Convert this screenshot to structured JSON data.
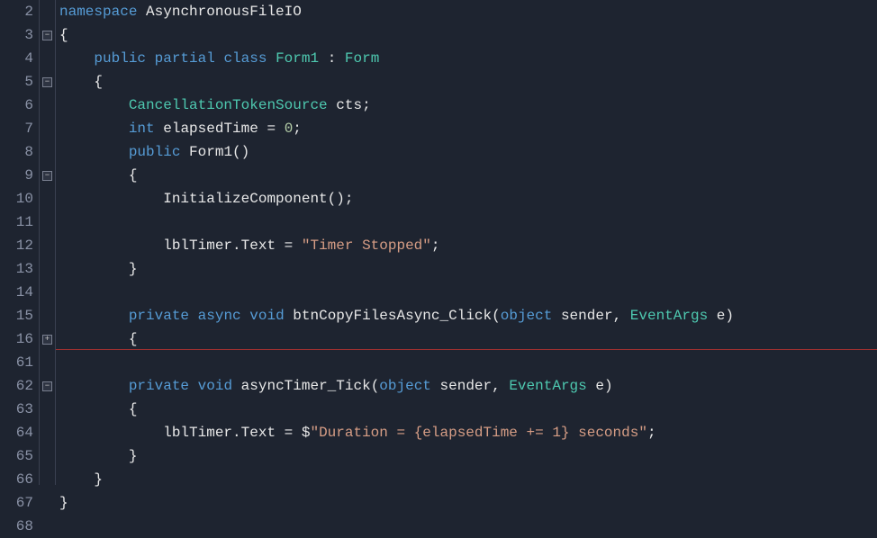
{
  "lineNumbers": [
    "2",
    "3",
    "4",
    "5",
    "6",
    "7",
    "8",
    "9",
    "10",
    "11",
    "12",
    "13",
    "14",
    "15",
    "16",
    "61",
    "62",
    "63",
    "64",
    "65",
    "66",
    "67",
    "68"
  ],
  "folds": [
    {
      "line": 1,
      "sym": "−"
    },
    {
      "line": 3,
      "sym": "−"
    },
    {
      "line": 7,
      "sym": "−"
    },
    {
      "line": 14,
      "sym": "+"
    },
    {
      "line": 16,
      "sym": "−"
    }
  ],
  "code": {
    "l2": {
      "kw1": "namespace",
      "id1": "AsynchronousFileIO"
    },
    "l3": {
      "p": "{"
    },
    "l4": {
      "kw1": "public",
      "kw2": "partial",
      "kw3": "class",
      "t1": "Form1",
      "p1": ":",
      "t2": "Form"
    },
    "l5": {
      "p": "{"
    },
    "l6": {
      "t1": "CancellationTokenSource",
      "id1": "cts",
      "p": ";"
    },
    "l7": {
      "kw1": "int",
      "id1": "elapsedTime",
      "p1": "=",
      "n1": "0",
      "p2": ";"
    },
    "l8": {
      "kw1": "public",
      "t1": "Form1",
      "p1": "()"
    },
    "l9": {
      "p": "{"
    },
    "l10": {
      "id1": "InitializeComponent",
      "p1": "();"
    },
    "l11": {
      "blank": ""
    },
    "l12": {
      "id1": "lblTimer",
      "p1": ".",
      "id2": "Text",
      "p2": " = ",
      "s1": "\"Timer Stopped\"",
      "p3": ";"
    },
    "l13": {
      "p": "}"
    },
    "l14": {
      "blank": ""
    },
    "l15": {
      "kw1": "private",
      "kw2": "async",
      "kw3": "void",
      "id1": "btnCopyFilesAsync_Click",
      "p1": "(",
      "kw4": "object",
      "id2": " sender",
      "p2": ", ",
      "t1": "EventArgs",
      "id3": " e",
      "p3": ")"
    },
    "l16": {
      "p": "{"
    },
    "l61": {
      "blank": ""
    },
    "l62": {
      "kw1": "private",
      "kw2": "void",
      "id1": "asyncTimer_Tick",
      "p1": "(",
      "kw3": "object",
      "id2": " sender",
      "p2": ", ",
      "t1": "EventArgs",
      "id3": " e",
      "p3": ")"
    },
    "l63": {
      "p": "{"
    },
    "l64": {
      "id1": "lblTimer",
      "p1": ".",
      "id2": "Text",
      "p2": " = ",
      "id3": "$",
      "s1": "\"Duration = {elapsedTime += 1} seconds\"",
      "p3": ";"
    },
    "l65": {
      "p": "}"
    },
    "l66": {
      "p": "}"
    },
    "l67": {
      "p": "}"
    },
    "l68": {
      "blank": ""
    }
  }
}
